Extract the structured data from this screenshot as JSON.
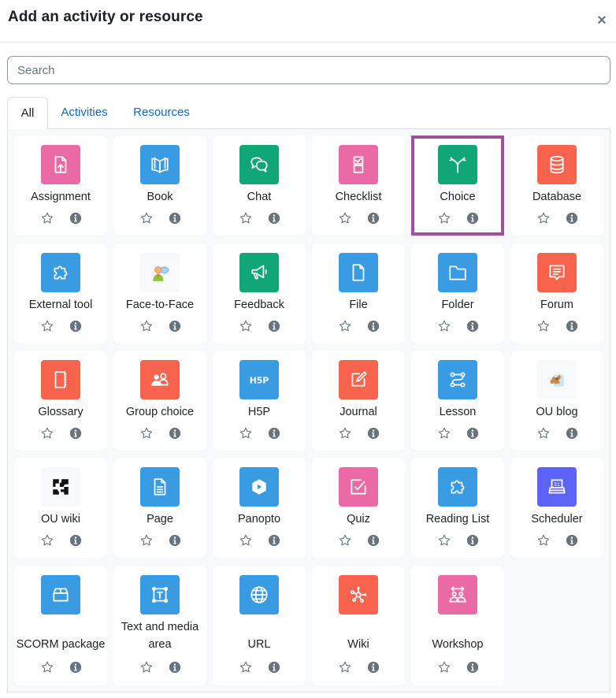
{
  "dialog": {
    "title": "Add an activity or resource",
    "close_label": "×"
  },
  "search": {
    "placeholder": "Search",
    "value": ""
  },
  "tabs": [
    {
      "label": "All",
      "active": true
    },
    {
      "label": "Activities",
      "active": false
    },
    {
      "label": "Resources",
      "active": false
    }
  ],
  "colors": {
    "assessment_pink": "#ea6aa5",
    "content_blue": "#399be2",
    "communication_green": "#11a676",
    "collaboration_red": "#f7634d",
    "interface_purple": "#5d63f6",
    "image_grey": "#f8f9fa",
    "selected_outline": "#a050a0",
    "link_blue": "#0f6cbf"
  },
  "items": [
    {
      "label": "Assignment",
      "icon": "assignment-icon",
      "color": "#ea6aa5",
      "selected": false
    },
    {
      "label": "Book",
      "icon": "book-icon",
      "color": "#399be2",
      "selected": false
    },
    {
      "label": "Chat",
      "icon": "chat-icon",
      "color": "#11a676",
      "selected": false
    },
    {
      "label": "Checklist",
      "icon": "checklist-icon",
      "color": "#ea6aa5",
      "selected": false
    },
    {
      "label": "Choice",
      "icon": "choice-icon",
      "color": "#11a676",
      "selected": true
    },
    {
      "label": "Database",
      "icon": "database-icon",
      "color": "#f7634d",
      "selected": false
    },
    {
      "label": "External tool",
      "icon": "puzzle-icon",
      "color": "#399be2",
      "selected": false
    },
    {
      "label": "Face-to-Face",
      "icon": "face-to-face-icon",
      "color": "#f8f9fa",
      "selected": false
    },
    {
      "label": "Feedback",
      "icon": "megaphone-icon",
      "color": "#11a676",
      "selected": false
    },
    {
      "label": "File",
      "icon": "file-icon",
      "color": "#399be2",
      "selected": false
    },
    {
      "label": "Folder",
      "icon": "folder-icon",
      "color": "#399be2",
      "selected": false
    },
    {
      "label": "Forum",
      "icon": "forum-icon",
      "color": "#f7634d",
      "selected": false
    },
    {
      "label": "Glossary",
      "icon": "glossary-icon",
      "color": "#f7634d",
      "selected": false
    },
    {
      "label": "Group choice",
      "icon": "group-icon",
      "color": "#f7634d",
      "selected": false
    },
    {
      "label": "H5P",
      "icon": "h5p-icon",
      "color": "#399be2",
      "selected": false
    },
    {
      "label": "Journal",
      "icon": "journal-icon",
      "color": "#f7634d",
      "selected": false
    },
    {
      "label": "Lesson",
      "icon": "lesson-icon",
      "color": "#399be2",
      "selected": false
    },
    {
      "label": "OU blog",
      "icon": "ou-blog-icon",
      "color": "#f8f9fa",
      "selected": false
    },
    {
      "label": "OU wiki",
      "icon": "ou-wiki-icon",
      "color": "#f8f9fa",
      "selected": false
    },
    {
      "label": "Page",
      "icon": "page-icon",
      "color": "#399be2",
      "selected": false
    },
    {
      "label": "Panopto",
      "icon": "panopto-icon",
      "color": "#399be2",
      "selected": false
    },
    {
      "label": "Quiz",
      "icon": "quiz-icon",
      "color": "#ea6aa5",
      "selected": false
    },
    {
      "label": "Reading List",
      "icon": "puzzle-icon",
      "color": "#399be2",
      "selected": false
    },
    {
      "label": "Scheduler",
      "icon": "scheduler-icon",
      "color": "#5d63f6",
      "selected": false
    },
    {
      "label": "SCORM package",
      "icon": "scorm-icon",
      "color": "#399be2",
      "selected": false
    },
    {
      "label": "Text and media area",
      "icon": "text-media-icon",
      "color": "#399be2",
      "selected": false
    },
    {
      "label": "URL",
      "icon": "globe-icon",
      "color": "#399be2",
      "selected": false
    },
    {
      "label": "Wiki",
      "icon": "wiki-icon",
      "color": "#f7634d",
      "selected": false
    },
    {
      "label": "Workshop",
      "icon": "workshop-icon",
      "color": "#ea6aa5",
      "selected": false
    }
  ]
}
